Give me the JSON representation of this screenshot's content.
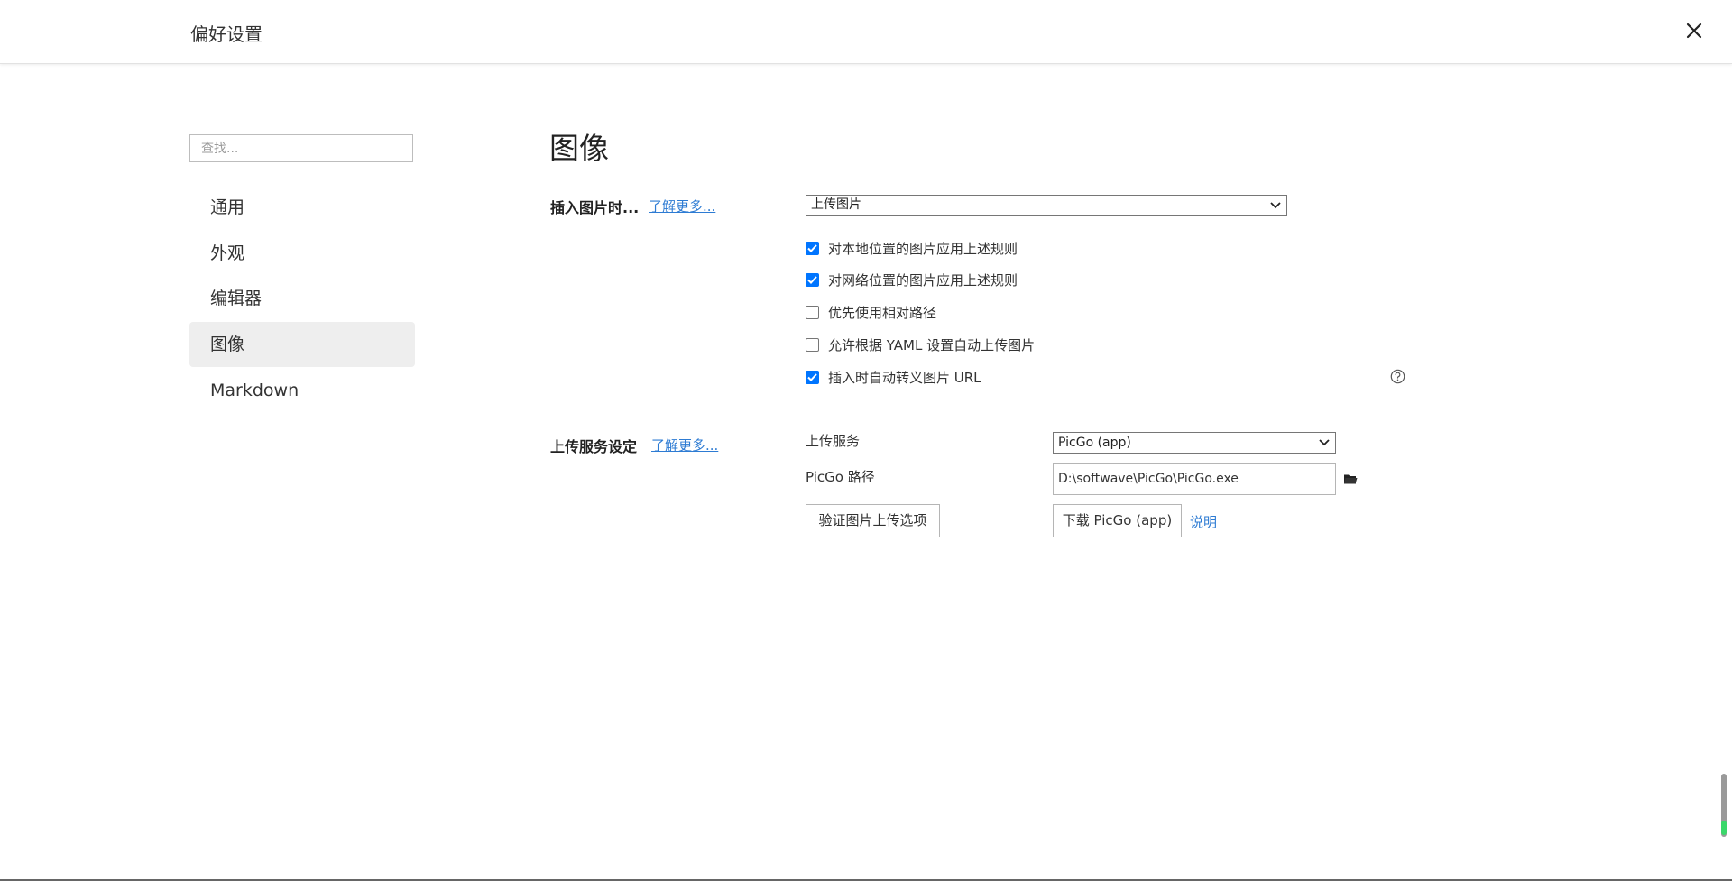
{
  "header": {
    "title": "偏好设置",
    "close_icon": "close-icon"
  },
  "sidebar": {
    "search_placeholder": "查找...",
    "items": [
      {
        "label": "通用",
        "active": false
      },
      {
        "label": "外观",
        "active": false
      },
      {
        "label": "编辑器",
        "active": false
      },
      {
        "label": "图像",
        "active": true
      },
      {
        "label": "Markdown",
        "active": false
      }
    ]
  },
  "main": {
    "title": "图像",
    "insert_section": {
      "label": "插入图片时...",
      "learn_more": "了解更多...",
      "action_select": "上传图片",
      "options": [
        {
          "label": "对本地位置的图片应用上述规则",
          "checked": true
        },
        {
          "label": "对网络位置的图片应用上述规则",
          "checked": true
        },
        {
          "label": "优先使用相对路径",
          "checked": false
        },
        {
          "label": "允许根据 YAML 设置自动上传图片",
          "checked": false
        },
        {
          "label": "插入时自动转义图片 URL",
          "checked": true
        }
      ],
      "help_icon": "question-circle-icon"
    },
    "upload_section": {
      "label": "上传服务设定",
      "learn_more": "了解更多...",
      "service_label": "上传服务",
      "service_value": "PicGo (app)",
      "path_label": "PicGo 路径",
      "path_value": "D:\\softwave\\PicGo\\PicGo.exe",
      "folder_icon": "folder-icon",
      "verify_button": "验证图片上传选项",
      "download_button": "下载 PicGo (app)",
      "doc_link": "说明"
    }
  },
  "colors": {
    "accent": "#0075ff",
    "link": "#2d7bd3",
    "active_nav_bg": "#eeeeee",
    "scroll_indicator": "#3ad86a"
  }
}
